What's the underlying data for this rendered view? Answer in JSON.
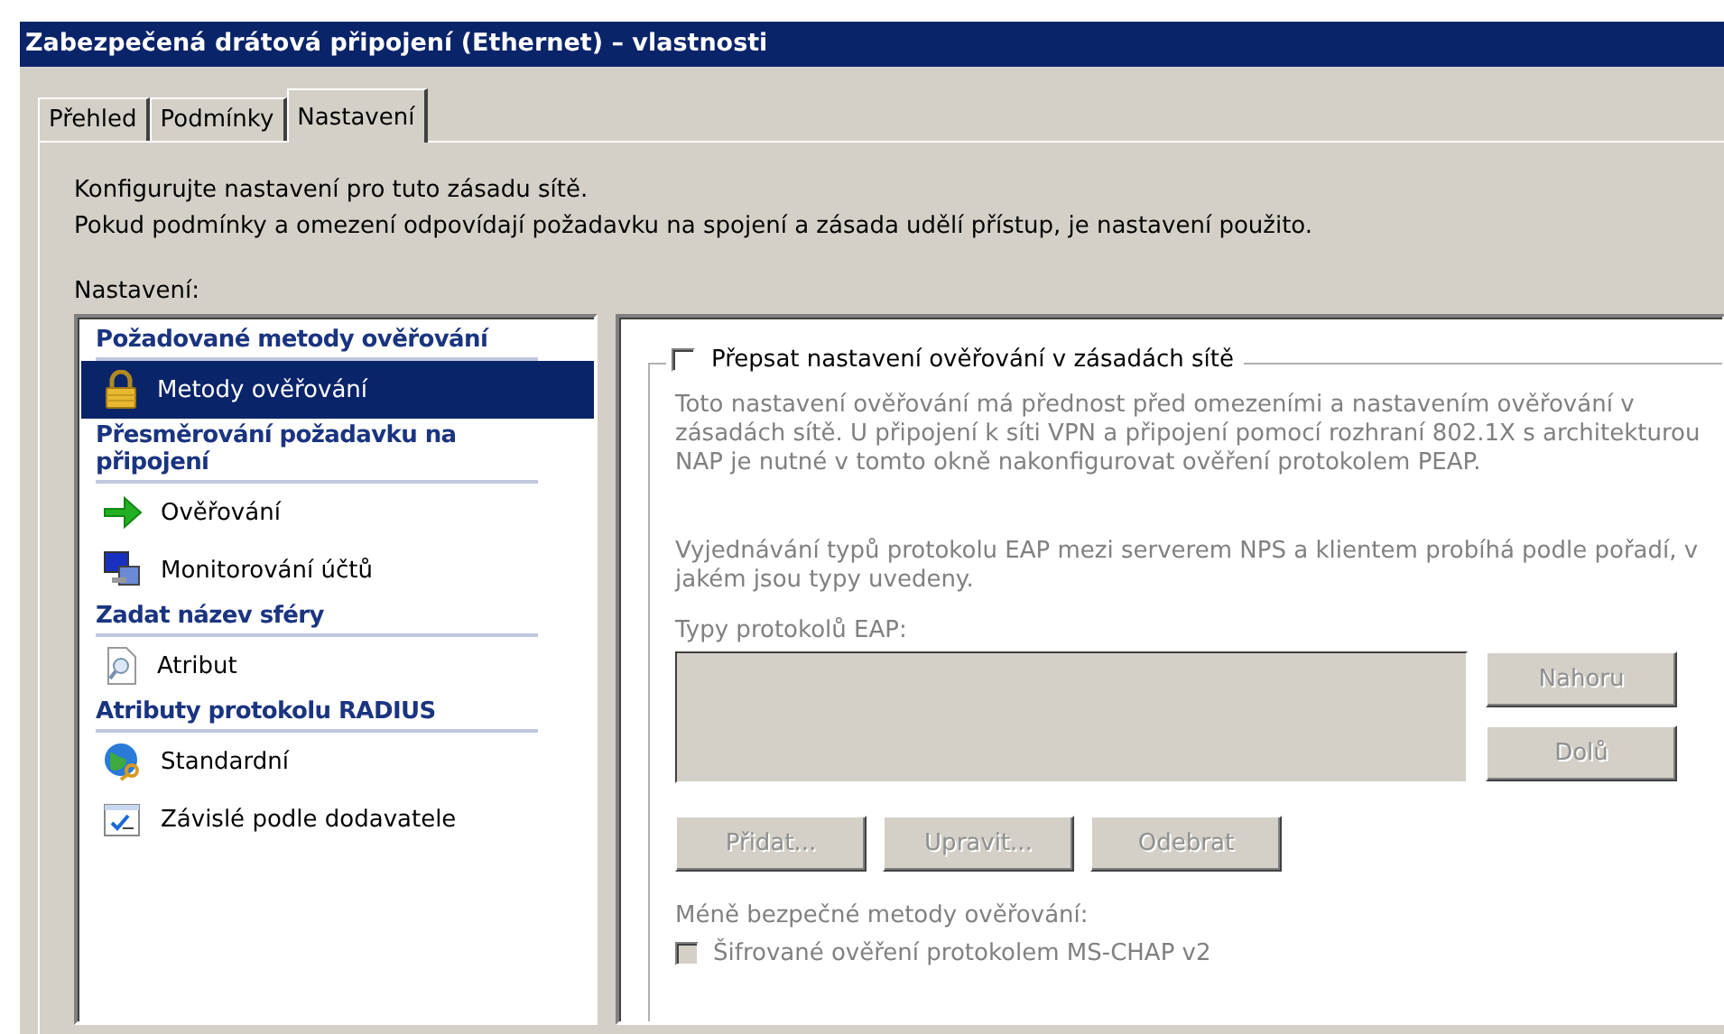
{
  "window": {
    "title": "Zabezpečená drátová připojení (Ethernet) – vlastnosti"
  },
  "tabs": [
    {
      "label": "Přehled",
      "selected": false
    },
    {
      "label": "Podmínky",
      "selected": false
    },
    {
      "label": "Nastavení",
      "selected": true
    }
  ],
  "intro": [
    "Konfigurujte nastavení pro tuto zásadu sítě.",
    "Pokud podmínky a omezení odpovídají požadavku na spojení a zásada udělí přístup, je nastavení použito."
  ],
  "settings_label": "Nastavení:",
  "sidebar": {
    "sections": [
      {
        "heading": "Požadované metody ověřování",
        "items": [
          {
            "label": "Metody ověřování",
            "kind": "lock",
            "selected": true
          }
        ]
      },
      {
        "heading": "Přesměrování požadavku na připojení",
        "items": [
          {
            "label": "Ověřování",
            "kind": "arrow",
            "selected": false
          },
          {
            "label": "Monitorování účtů",
            "kind": "monitor",
            "selected": false
          }
        ]
      },
      {
        "heading": "Zadat název sféry",
        "items": [
          {
            "label": "Atribut",
            "kind": "document",
            "selected": false
          }
        ]
      },
      {
        "heading": "Atributy protokolu RADIUS",
        "items": [
          {
            "label": "Standardní",
            "kind": "globe",
            "selected": false
          },
          {
            "label": "Závislé podle dodavatele",
            "kind": "checklist",
            "selected": false
          }
        ]
      }
    ]
  },
  "override": {
    "label": "Přepsat nastavení ověřování v zásadách sítě",
    "checked": false
  },
  "details": {
    "disabled": true,
    "notes": [
      "Toto nastavení ověřování má přednost před omezeními a nastavením ověřování v zásadách sítě. U připojení k síti VPN a připojení pomocí rozhraní 802.1X s architekturou NAP je nutné v tomto okně nakonfigurovat ověření protokolem PEAP.",
      "Vyjednávání typů protokolu EAP mezi serverem NPS a klientem probíhá podle pořadí, v jakém jsou typy uvedeny."
    ],
    "eap_label": "Typy protokolů EAP:",
    "side_buttons": [
      "Nahoru",
      "Dolů"
    ],
    "list_buttons": [
      "Přidat...",
      "Upravit...",
      "Odebrat"
    ],
    "less_secure_label": "Méně bezpečné metody ověřování:",
    "methods": [
      {
        "label": "Šifrované ověření protokolem MS-CHAP v2",
        "checked": false
      }
    ]
  }
}
